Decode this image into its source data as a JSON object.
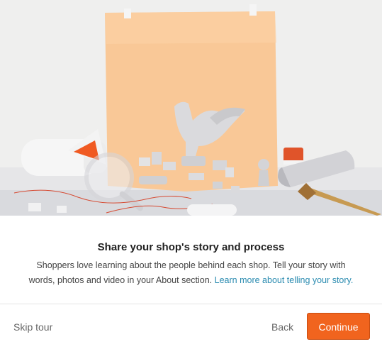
{
  "hero": {
    "image_description_icon": "studio-still-life-image"
  },
  "content": {
    "title": "Share your shop's story and process",
    "body_text": "Shoppers love learning about the people behind each shop. Tell your story with words, photos and video in your About section. ",
    "learn_link": "Learn more about telling your story."
  },
  "footer": {
    "skip_label": "Skip tour",
    "back_label": "Back",
    "continue_label": "Continue"
  },
  "colors": {
    "accent": "#f1641e",
    "link": "#2a8bb0",
    "paper": "#f9c897"
  }
}
